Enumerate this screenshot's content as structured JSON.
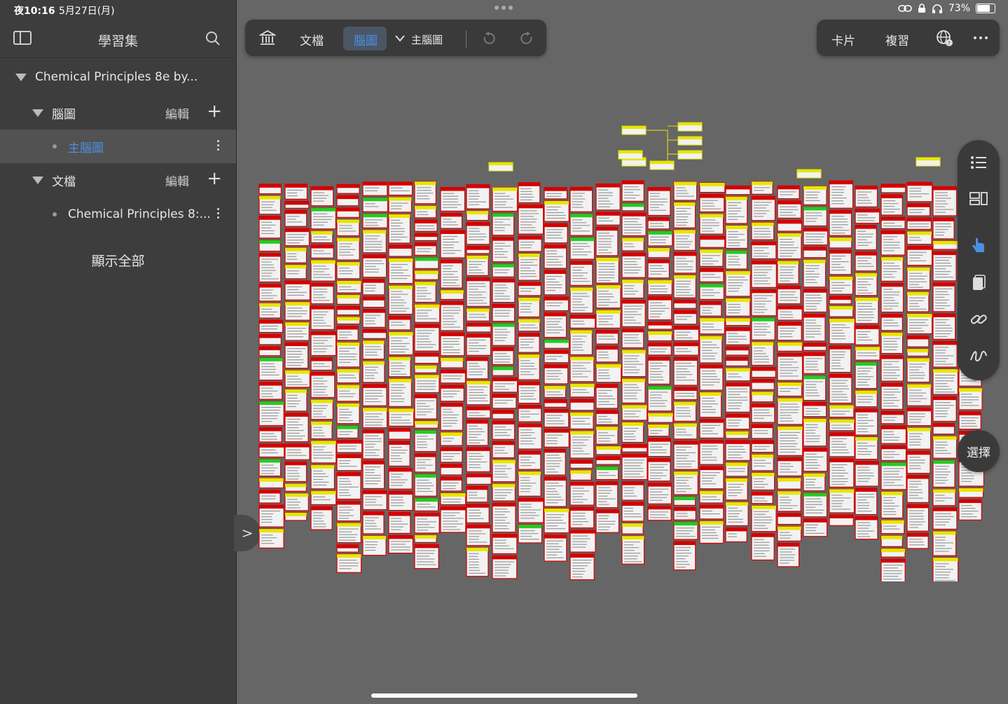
{
  "status": {
    "time": "夜10:16",
    "date": "5月27日(月)",
    "battery": "73%"
  },
  "sidebar": {
    "title": "學習集",
    "project": "Chemical Principles 8e by...",
    "groups": [
      {
        "label": "腦圖",
        "edit": "編輯",
        "items": [
          {
            "label": "主腦圖",
            "selected": true
          }
        ]
      },
      {
        "label": "文檔",
        "edit": "編輯",
        "items": [
          {
            "label": "Chemical Principles 8:...",
            "selected": false
          }
        ]
      }
    ],
    "show_all": "顯示全部",
    "selected_color": "#4a90e2"
  },
  "toolbar_left": {
    "library": "library-icon",
    "doc": "文檔",
    "mindmap": "腦圖",
    "map_name": "主腦圖"
  },
  "toolbar_right": {
    "cards": "卡片",
    "review": "複習"
  },
  "select_button": "選擇",
  "colors": {
    "card_red": "#d40000",
    "card_yellow": "#e6e600",
    "card_green": "#22cc22",
    "canvas_bg": "#666666"
  }
}
